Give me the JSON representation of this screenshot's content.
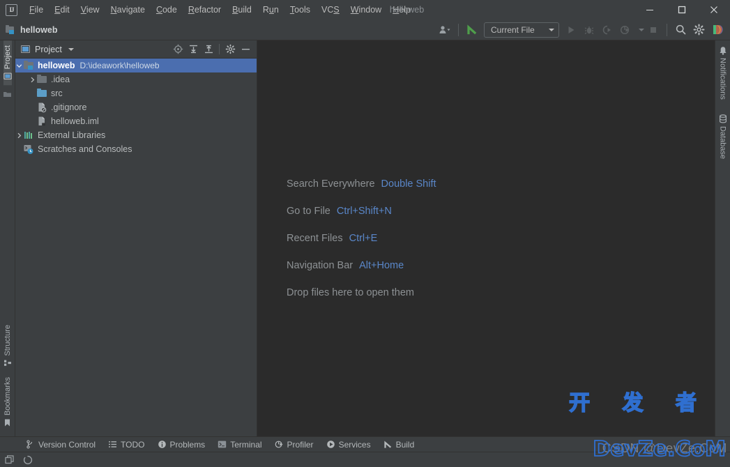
{
  "window": {
    "title": "helloweb",
    "logo_text": "IJ",
    "controls": [
      {
        "name": "minimize",
        "glyph": "minimize-icon"
      },
      {
        "name": "maximize",
        "glyph": "maximize-icon"
      },
      {
        "name": "close",
        "glyph": "close-icon"
      }
    ]
  },
  "menu": [
    {
      "label": "File",
      "mnemonic": "F"
    },
    {
      "label": "Edit",
      "mnemonic": "E"
    },
    {
      "label": "View",
      "mnemonic": "V"
    },
    {
      "label": "Navigate",
      "mnemonic": "N"
    },
    {
      "label": "Code",
      "mnemonic": "C"
    },
    {
      "label": "Refactor",
      "mnemonic": "R"
    },
    {
      "label": "Build",
      "mnemonic": "B"
    },
    {
      "label": "Run",
      "mnemonic": "u"
    },
    {
      "label": "Tools",
      "mnemonic": "T"
    },
    {
      "label": "VCS",
      "mnemonic": "S"
    },
    {
      "label": "Window",
      "mnemonic": "W"
    },
    {
      "label": "Help",
      "mnemonic": "H"
    }
  ],
  "toolbar": {
    "breadcrumb": "helloweb",
    "run_config": "Current File",
    "icons": [
      "user-account-icon",
      "updates-icon",
      "run-icon",
      "debug-icon",
      "run-with-coverage-icon",
      "profiler-icon",
      "stop-icon",
      "search-icon",
      "settings-gear-icon",
      "ide-assistant-icon"
    ]
  },
  "left_rail": {
    "top": [
      {
        "label": "Project",
        "icon": "project-icon",
        "active": true
      },
      {
        "label": "",
        "icon": "folder-icon",
        "active": false
      }
    ],
    "bottom": [
      {
        "label": "Structure",
        "icon": "structure-icon",
        "active": false
      },
      {
        "label": "Bookmarks",
        "icon": "bookmark-icon",
        "active": false
      }
    ]
  },
  "right_rail": [
    {
      "label": "Notifications",
      "icon": "bell-icon"
    },
    {
      "label": "Database",
      "icon": "database-icon"
    }
  ],
  "project_panel": {
    "title": "Project",
    "tools": [
      "select-opened-file-icon",
      "expand-all-icon",
      "collapse-all-icon",
      "settings-gear-icon",
      "hide-panel-icon"
    ],
    "tree": [
      {
        "label": "helloweb",
        "sub": "D:\\ideawork\\helloweb",
        "icon": "module-icon",
        "arrow": "expanded",
        "indent": 0,
        "selected": true
      },
      {
        "label": ".idea",
        "sub": "",
        "icon": "folder-gray-icon",
        "arrow": "collapsed",
        "indent": 1,
        "selected": false
      },
      {
        "label": "src",
        "sub": "",
        "icon": "folder-blue-icon",
        "arrow": "none",
        "indent": 1,
        "selected": false
      },
      {
        "label": ".gitignore",
        "sub": "",
        "icon": "gitignore-file-icon",
        "arrow": "none",
        "indent": 1,
        "selected": false
      },
      {
        "label": "helloweb.iml",
        "sub": "",
        "icon": "iml-file-icon",
        "arrow": "none",
        "indent": 1,
        "selected": false
      },
      {
        "label": "External Libraries",
        "sub": "",
        "icon": "libraries-icon",
        "arrow": "collapsed",
        "indent": 0,
        "selected": false
      },
      {
        "label": "Scratches and Consoles",
        "sub": "",
        "icon": "scratches-icon",
        "arrow": "none",
        "indent": 0,
        "selected": false
      }
    ]
  },
  "editor": {
    "hints": [
      {
        "label": "Search Everywhere",
        "key": "Double Shift"
      },
      {
        "label": "Go to File",
        "key": "Ctrl+Shift+N"
      },
      {
        "label": "Recent Files",
        "key": "Ctrl+E"
      },
      {
        "label": "Navigation Bar",
        "key": "Alt+Home"
      },
      {
        "label": "Drop files here to open them",
        "key": ""
      }
    ]
  },
  "watermark": {
    "csdn": "CSDN @DevZe.CoM",
    "chinese": "开 发 者",
    "site": "DevZe.CoM"
  },
  "tool_windows": [
    {
      "label": "Version Control",
      "icon": "branch-icon"
    },
    {
      "label": "TODO",
      "icon": "todo-list-icon"
    },
    {
      "label": "Problems",
      "icon": "problems-icon"
    },
    {
      "label": "Terminal",
      "icon": "terminal-icon"
    },
    {
      "label": "Profiler",
      "icon": "profiler-icon"
    },
    {
      "label": "Services",
      "icon": "services-icon"
    },
    {
      "label": "Build",
      "icon": "build-hammer-icon"
    }
  ],
  "status_bar": {
    "icons": [
      "layout-icon",
      "progress-spinner-icon"
    ]
  },
  "colors": {
    "panel_bg": "#3c3f41",
    "editor_bg": "#2b2b2b",
    "selection_blue": "#4b6eaf",
    "accent_link": "#5a87c9",
    "folder_blue": "#5c9ec7",
    "watermark_blue": "#2f6fd0"
  }
}
